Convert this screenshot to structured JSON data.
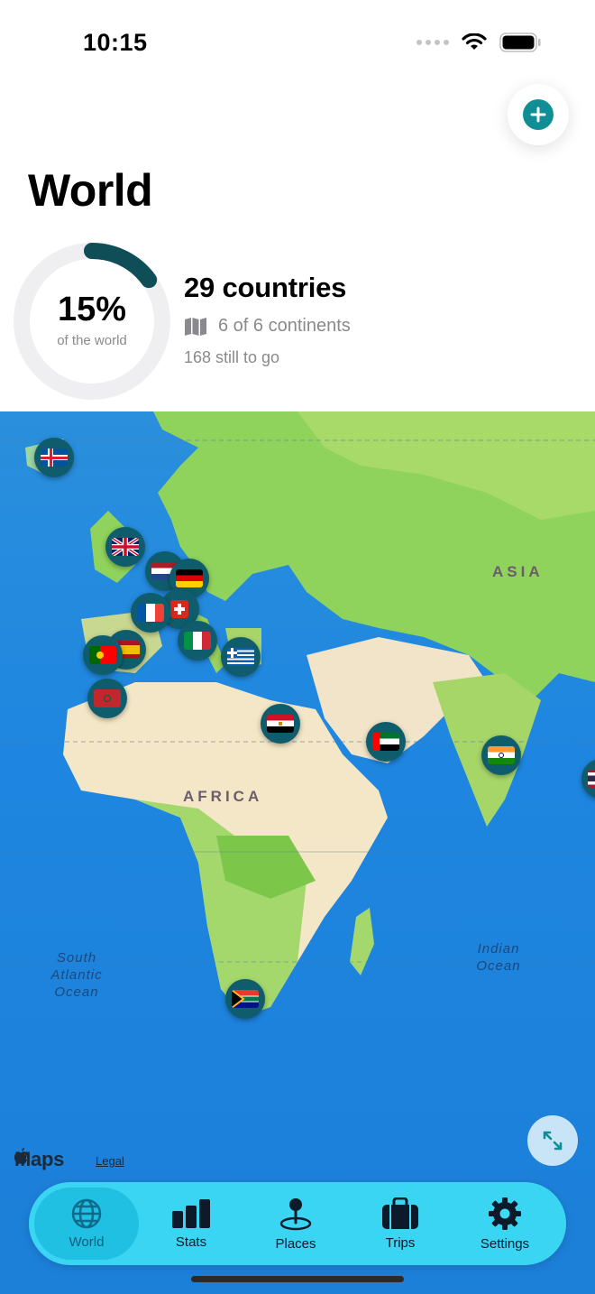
{
  "status_bar": {
    "time": "10:15"
  },
  "header": {
    "title": "World"
  },
  "summary": {
    "percent": "15%",
    "percent_value": 0.15,
    "percent_caption": "of the world",
    "countries": "29 countries",
    "continents": "6 of 6 continents",
    "remaining": "168 still to go"
  },
  "map": {
    "region_labels": {
      "asia": "ASIA",
      "africa": "AFRICA"
    },
    "ocean_labels": {
      "south_atlantic": "South Atlantic Ocean",
      "indian": "Indian Ocean"
    },
    "brand": "Maps",
    "legal": "Legal"
  },
  "tabs": [
    {
      "label": "World",
      "icon": "globe-icon",
      "active": true
    },
    {
      "label": "Stats",
      "icon": "bar-chart-icon",
      "active": false
    },
    {
      "label": "Places",
      "icon": "map-pin-icon",
      "active": false
    },
    {
      "label": "Trips",
      "icon": "suitcase-icon",
      "active": false
    },
    {
      "label": "Settings",
      "icon": "gear-icon",
      "active": false
    }
  ],
  "colors": {
    "accent": "#0f8e96",
    "ring": "#0f4d57",
    "tab_bar": "#3cdcf5"
  }
}
